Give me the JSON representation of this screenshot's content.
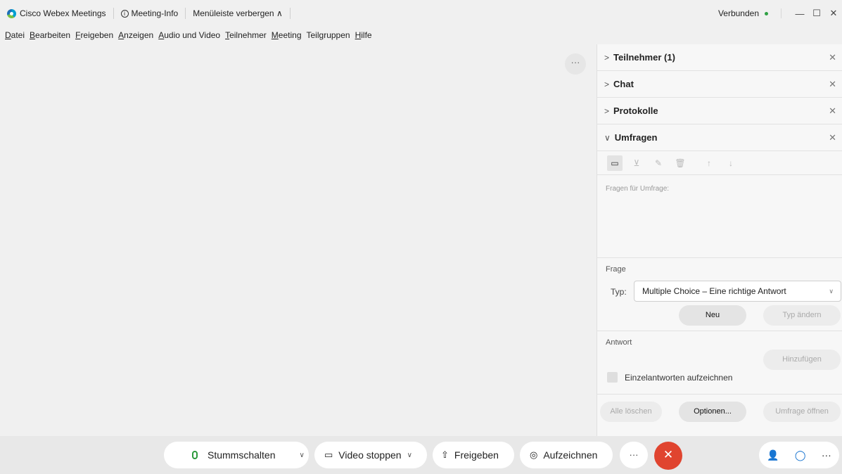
{
  "titlebar": {
    "app_name": "Cisco Webex Meetings",
    "meeting_info": "Meeting-Info",
    "hide_menu": "Menüleiste verbergen ∧",
    "status": "Verbunden",
    "status_color": "#2ea043"
  },
  "menu": [
    {
      "pre": "",
      "u": "D",
      "post": "atei"
    },
    {
      "pre": "",
      "u": "B",
      "post": "earbeiten"
    },
    {
      "pre": "",
      "u": "F",
      "post": "reigeben"
    },
    {
      "pre": "",
      "u": "A",
      "post": "nzeigen"
    },
    {
      "pre": "",
      "u": "A",
      "post": "udio und Video"
    },
    {
      "pre": "",
      "u": "T",
      "post": "eilnehmer"
    },
    {
      "pre": "",
      "u": "M",
      "post": "eeting"
    },
    {
      "pre": "Teil",
      "u": "g",
      "post": "ruppen"
    },
    {
      "pre": "",
      "u": "H",
      "post": "ilfe"
    }
  ],
  "panel": {
    "participants": "Teilnehmer (1)",
    "chat": "Chat",
    "logs": "Protokolle",
    "polls": "Umfragen",
    "questions_label": "Fragen für Umfrage:",
    "question_section": "Frage",
    "type_label": "Typ:",
    "type_value": "Multiple Choice – Eine richtige Antwort",
    "new_button": "Neu",
    "change_type_button": "Typ ändern",
    "answer_section": "Antwort",
    "add_button": "Hinzufügen",
    "record_individual": "Einzelantworten aufzeichnen",
    "clear_all": "Alle löschen",
    "options": "Optionen...",
    "open_poll": "Umfrage öffnen"
  },
  "toolbar": {
    "mute": "Stummschalten",
    "stop_video": "Video stoppen",
    "share": "Freigeben",
    "record": "Aufzeichnen",
    "end_color": "#e0442f"
  }
}
